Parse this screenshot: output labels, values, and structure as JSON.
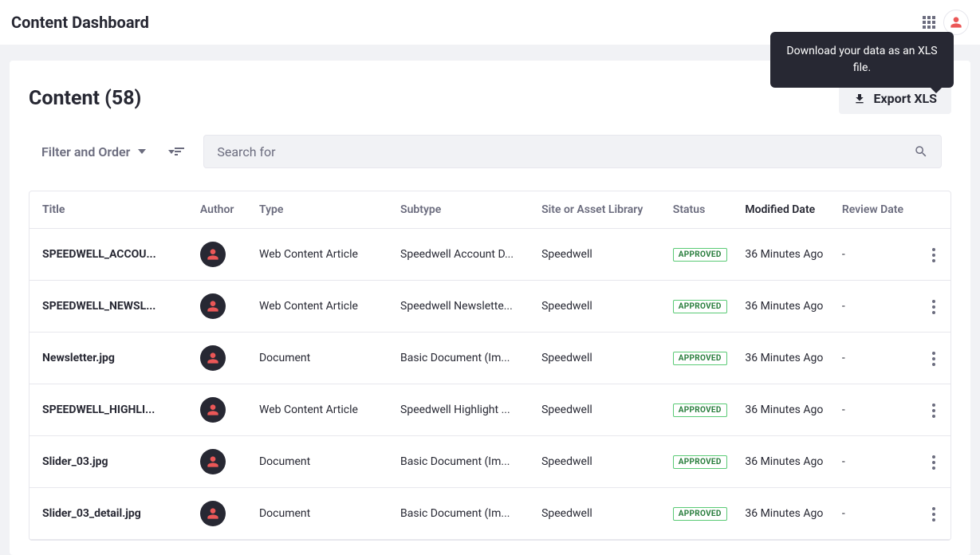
{
  "header": {
    "title": "Content Dashboard"
  },
  "tooltip": "Download your data as an XLS file.",
  "panel": {
    "title": "Content (58)",
    "export_label": "Export XLS",
    "filter_label": "Filter and Order",
    "search_placeholder": "Search for"
  },
  "columns": {
    "title": "Title",
    "author": "Author",
    "type": "Type",
    "subtype": "Subtype",
    "site": "Site or Asset Library",
    "status": "Status",
    "modified": "Modified Date",
    "review": "Review Date"
  },
  "rows": [
    {
      "title": "SPEEDWELL_ACCOU...",
      "type": "Web Content Article",
      "subtype": "Speedwell Account D...",
      "site": "Speedwell",
      "status": "APPROVED",
      "modified": "36 Minutes Ago",
      "review": "-"
    },
    {
      "title": "SPEEDWELL_NEWSL...",
      "type": "Web Content Article",
      "subtype": "Speedwell Newslette...",
      "site": "Speedwell",
      "status": "APPROVED",
      "modified": "36 Minutes Ago",
      "review": "-"
    },
    {
      "title": "Newsletter.jpg",
      "type": "Document",
      "subtype": "Basic Document (Im...",
      "site": "Speedwell",
      "status": "APPROVED",
      "modified": "36 Minutes Ago",
      "review": "-"
    },
    {
      "title": "SPEEDWELL_HIGHLI...",
      "type": "Web Content Article",
      "subtype": "Speedwell Highlight ...",
      "site": "Speedwell",
      "status": "APPROVED",
      "modified": "36 Minutes Ago",
      "review": "-"
    },
    {
      "title": "Slider_03.jpg",
      "type": "Document",
      "subtype": "Basic Document (Im...",
      "site": "Speedwell",
      "status": "APPROVED",
      "modified": "36 Minutes Ago",
      "review": "-"
    },
    {
      "title": "Slider_03_detail.jpg",
      "type": "Document",
      "subtype": "Basic Document (Im...",
      "site": "Speedwell",
      "status": "APPROVED",
      "modified": "36 Minutes Ago",
      "review": "-"
    }
  ]
}
